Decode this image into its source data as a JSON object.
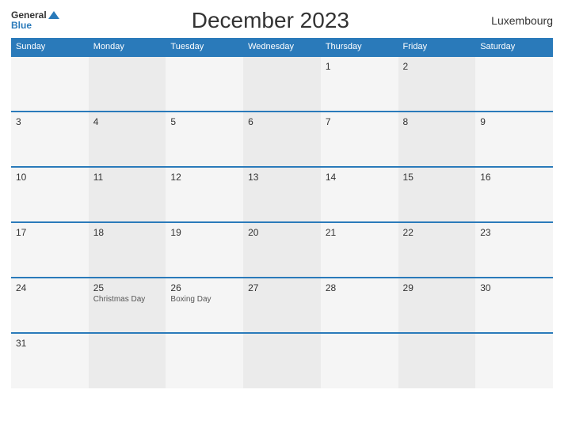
{
  "header": {
    "logo_general": "General",
    "logo_blue": "Blue",
    "title": "December 2023",
    "country": "Luxembourg"
  },
  "calendar": {
    "days_of_week": [
      "Sunday",
      "Monday",
      "Tuesday",
      "Wednesday",
      "Thursday",
      "Friday",
      "Saturday"
    ],
    "weeks": [
      [
        {
          "num": "",
          "holiday": ""
        },
        {
          "num": "",
          "holiday": ""
        },
        {
          "num": "",
          "holiday": ""
        },
        {
          "num": "",
          "holiday": ""
        },
        {
          "num": "1",
          "holiday": ""
        },
        {
          "num": "2",
          "holiday": ""
        },
        {
          "num": "",
          "holiday": ""
        }
      ],
      [
        {
          "num": "3",
          "holiday": ""
        },
        {
          "num": "4",
          "holiday": ""
        },
        {
          "num": "5",
          "holiday": ""
        },
        {
          "num": "6",
          "holiday": ""
        },
        {
          "num": "7",
          "holiday": ""
        },
        {
          "num": "8",
          "holiday": ""
        },
        {
          "num": "9",
          "holiday": ""
        }
      ],
      [
        {
          "num": "10",
          "holiday": ""
        },
        {
          "num": "11",
          "holiday": ""
        },
        {
          "num": "12",
          "holiday": ""
        },
        {
          "num": "13",
          "holiday": ""
        },
        {
          "num": "14",
          "holiday": ""
        },
        {
          "num": "15",
          "holiday": ""
        },
        {
          "num": "16",
          "holiday": ""
        }
      ],
      [
        {
          "num": "17",
          "holiday": ""
        },
        {
          "num": "18",
          "holiday": ""
        },
        {
          "num": "19",
          "holiday": ""
        },
        {
          "num": "20",
          "holiday": ""
        },
        {
          "num": "21",
          "holiday": ""
        },
        {
          "num": "22",
          "holiday": ""
        },
        {
          "num": "23",
          "holiday": ""
        }
      ],
      [
        {
          "num": "24",
          "holiday": ""
        },
        {
          "num": "25",
          "holiday": "Christmas Day"
        },
        {
          "num": "26",
          "holiday": "Boxing Day"
        },
        {
          "num": "27",
          "holiday": ""
        },
        {
          "num": "28",
          "holiday": ""
        },
        {
          "num": "29",
          "holiday": ""
        },
        {
          "num": "30",
          "holiday": ""
        }
      ],
      [
        {
          "num": "31",
          "holiday": ""
        },
        {
          "num": "",
          "holiday": ""
        },
        {
          "num": "",
          "holiday": ""
        },
        {
          "num": "",
          "holiday": ""
        },
        {
          "num": "",
          "holiday": ""
        },
        {
          "num": "",
          "holiday": ""
        },
        {
          "num": "",
          "holiday": ""
        }
      ]
    ]
  }
}
